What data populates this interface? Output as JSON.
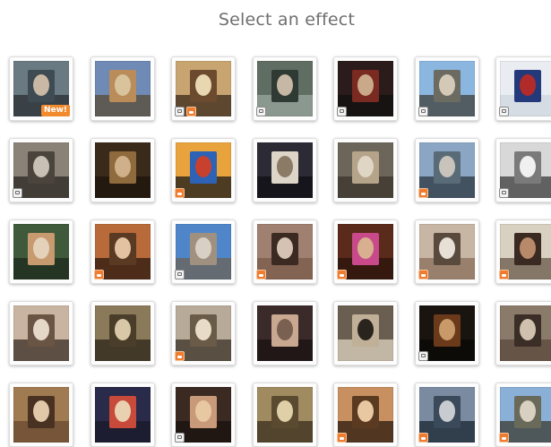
{
  "header": {
    "title": "Select an effect"
  },
  "badges": {
    "new_label": "New!"
  },
  "colors": {
    "accent_orange": "#f28a2e",
    "background": "#ffffff",
    "title_text": "#6f6f6f"
  },
  "effects": [
    {
      "badges": [],
      "is_new": true,
      "palette": [
        "#6a7a82",
        "#3f4b52",
        "#c9b9a4",
        "#2a2f33"
      ]
    },
    {
      "badges": [],
      "is_new": false,
      "palette": [
        "#6e8ab5",
        "#b98c5a",
        "#d8c39c",
        "#5a4a36"
      ]
    },
    {
      "badges": [
        "mono",
        "print"
      ],
      "is_new": false,
      "palette": [
        "#c8a471",
        "#6b4a2d",
        "#e8d7b0",
        "#3a2a1a"
      ]
    },
    {
      "badges": [
        "mono"
      ],
      "is_new": false,
      "palette": [
        "#5f6d62",
        "#2f3a35",
        "#c6b8a4",
        "#9aa7a0"
      ]
    },
    {
      "badges": [
        "mono"
      ],
      "is_new": false,
      "palette": [
        "#2b1b1b",
        "#7a2a20",
        "#c9a98a",
        "#111111"
      ]
    },
    {
      "badges": [
        "mono"
      ],
      "is_new": false,
      "palette": [
        "#8bb6e0",
        "#6b6b62",
        "#d4c9b6",
        "#3f3f3a"
      ]
    },
    {
      "badges": [
        "mono"
      ],
      "is_new": false,
      "palette": [
        "#e9edf2",
        "#23397a",
        "#b22b2b",
        "#cfd6df"
      ]
    },
    {
      "badges": [
        "mono"
      ],
      "is_new": false,
      "palette": [
        "#8a8276",
        "#4a443c",
        "#c8c0b4",
        "#2a2622"
      ]
    },
    {
      "badges": [],
      "is_new": false,
      "palette": [
        "#3a2a1a",
        "#8f6a3c",
        "#d0b08a",
        "#1c140c"
      ]
    },
    {
      "badges": [
        "print"
      ],
      "is_new": false,
      "palette": [
        "#e8a33c",
        "#2d62b5",
        "#c8402e",
        "#1a1a1a"
      ]
    },
    {
      "badges": [],
      "is_new": false,
      "palette": [
        "#2c2a34",
        "#ddd6c8",
        "#8a7a66",
        "#0f0f14"
      ]
    },
    {
      "badges": [],
      "is_new": false,
      "palette": [
        "#6c655a",
        "#b5a48a",
        "#e0d6c6",
        "#3a342c"
      ]
    },
    {
      "badges": [
        "print"
      ],
      "is_new": false,
      "palette": [
        "#8aa6c4",
        "#5a6b78",
        "#c8c4bc",
        "#2a3640"
      ]
    },
    {
      "badges": [
        "mono"
      ],
      "is_new": false,
      "palette": [
        "#d8d8d8",
        "#7a7a7a",
        "#f0f0f0",
        "#3a3a3a"
      ]
    },
    {
      "badges": [],
      "is_new": false,
      "palette": [
        "#3f5a3a",
        "#c89a70",
        "#e3d2b9",
        "#1e2a1c"
      ]
    },
    {
      "badges": [
        "print"
      ],
      "is_new": false,
      "palette": [
        "#b86a3a",
        "#5a3a22",
        "#e2c2a0",
        "#2a1a10"
      ]
    },
    {
      "badges": [
        "mono"
      ],
      "is_new": false,
      "palette": [
        "#4f86c9",
        "#a09080",
        "#d8d0c4",
        "#6b6256"
      ]
    },
    {
      "badges": [
        "print"
      ],
      "is_new": false,
      "palette": [
        "#a08070",
        "#3a2a22",
        "#d6c2b2",
        "#7a5a48"
      ]
    },
    {
      "badges": [
        "print"
      ],
      "is_new": false,
      "palette": [
        "#5a2a1a",
        "#c84a8a",
        "#d8b090",
        "#2a140c"
      ]
    },
    {
      "badges": [
        "print"
      ],
      "is_new": false,
      "palette": [
        "#c8b6a4",
        "#5a4a3e",
        "#e8e0d6",
        "#8a6e5a"
      ]
    },
    {
      "badges": [
        "print"
      ],
      "is_new": false,
      "palette": [
        "#d8d0c0",
        "#3a2a22",
        "#b88a6a",
        "#6a5a4a"
      ]
    },
    {
      "badges": [],
      "is_new": false,
      "palette": [
        "#c8b4a0",
        "#6a5444",
        "#e6d8c8",
        "#3a2e26"
      ]
    },
    {
      "badges": [],
      "is_new": false,
      "palette": [
        "#8a7a5a",
        "#4a3e2a",
        "#d8c8a8",
        "#2a2418"
      ]
    },
    {
      "badges": [
        "print"
      ],
      "is_new": false,
      "palette": [
        "#b8aa98",
        "#6a5a48",
        "#e8dcc8",
        "#3a3026"
      ]
    },
    {
      "badges": [],
      "is_new": false,
      "palette": [
        "#3a2a2a",
        "#c8a890",
        "#7a6050",
        "#1a1212"
      ]
    },
    {
      "badges": [],
      "is_new": false,
      "palette": [
        "#6a5e50",
        "#c0b098",
        "#2a241e",
        "#e0d4c0"
      ]
    },
    {
      "badges": [
        "mono"
      ],
      "is_new": false,
      "palette": [
        "#1a1410",
        "#6a3a1a",
        "#c89a6a",
        "#0a0806"
      ]
    },
    {
      "badges": [],
      "is_new": false,
      "palette": [
        "#8a7a6a",
        "#3a2e26",
        "#d0c0ae",
        "#5a4a3c"
      ]
    },
    {
      "badges": [],
      "is_new": false,
      "palette": [
        "#a07a50",
        "#4a3222",
        "#e0c8a8",
        "#6a4a30"
      ]
    },
    {
      "badges": [],
      "is_new": false,
      "palette": [
        "#2a2a4a",
        "#c84a3a",
        "#e8d0b0",
        "#1a1a2a"
      ]
    },
    {
      "badges": [
        "mono"
      ],
      "is_new": false,
      "palette": [
        "#3a2a22",
        "#c89a7a",
        "#e8c8a0",
        "#1a120e"
      ]
    },
    {
      "badges": [],
      "is_new": false,
      "palette": [
        "#a08a60",
        "#5a4a30",
        "#e0d0a8",
        "#3a2e1c"
      ]
    },
    {
      "badges": [
        "print"
      ],
      "is_new": false,
      "palette": [
        "#c89060",
        "#5a3a20",
        "#e8c8a0",
        "#2a1a0e"
      ]
    },
    {
      "badges": [
        "print"
      ],
      "is_new": false,
      "palette": [
        "#7a8aa0",
        "#3a4a5a",
        "#c8ccd0",
        "#1a2430"
      ]
    },
    {
      "badges": [
        "print"
      ],
      "is_new": false,
      "palette": [
        "#8ab0d8",
        "#6a6a5a",
        "#d8d0c0",
        "#3a3a30"
      ]
    }
  ]
}
